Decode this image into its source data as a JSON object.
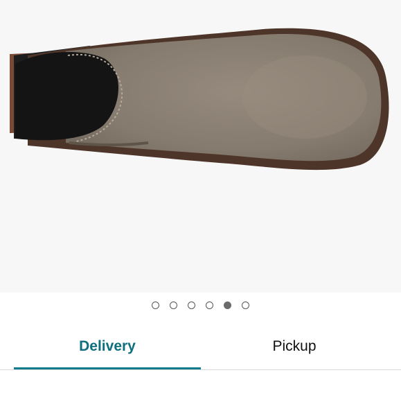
{
  "product_image": {
    "alt": "product-image",
    "carousel": {
      "total": 6,
      "active_index": 4
    }
  },
  "tabs": [
    {
      "label": "Delivery",
      "selected": true
    },
    {
      "label": "Pickup",
      "selected": false
    }
  ],
  "colors": {
    "accent": "#0e7a8a",
    "tab_text_selected": "#0e6f7e",
    "suede": "#8a8074",
    "sole": "#4e3529"
  }
}
